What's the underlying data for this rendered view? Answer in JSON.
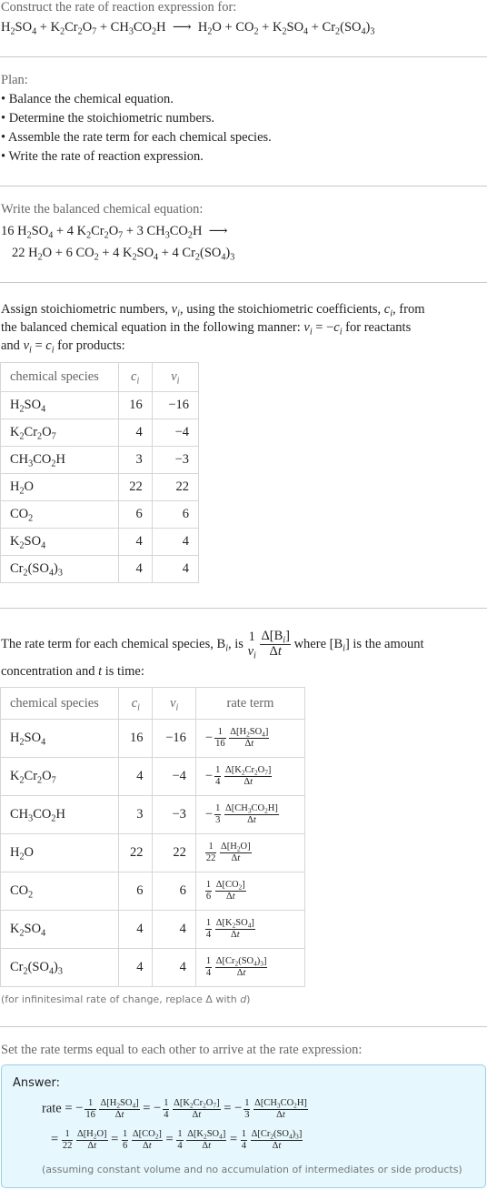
{
  "intro": {
    "prompt": "Construct the rate of reaction expression for:",
    "reaction": {
      "reactants": [
        "H2SO4",
        "K2Cr2O7",
        "CH3CO2H"
      ],
      "products": [
        "H2O",
        "CO2",
        "K2SO4",
        "Cr2(SO4)3"
      ],
      "arrow": "⟶"
    }
  },
  "plan": {
    "title": "Plan:",
    "steps": [
      "• Balance the chemical equation.",
      "• Determine the stoichiometric numbers.",
      "• Assemble the rate term for each chemical species.",
      "• Write the rate of reaction expression."
    ]
  },
  "balanced": {
    "title": "Write the balanced chemical equation:",
    "line1": "16 H2SO4 + 4 K2Cr2O7 + 3 CH3CO2H ⟶",
    "line2": "22 H2O + 6 CO2 + 4 K2SO4 + 4 Cr2(SO4)3"
  },
  "stoich": {
    "text_line1": "Assign stoichiometric numbers, νi, using the stoichiometric coefficients, ci, from",
    "text_line2": "the balanced chemical equation in the following manner: νi = −ci for reactants",
    "text_line3": "and νi = ci for products:",
    "headers": [
      "chemical species",
      "ci",
      "νi"
    ],
    "rows": [
      {
        "species": "H2SO4",
        "c": "16",
        "nu": "−16"
      },
      {
        "species": "K2Cr2O7",
        "c": "4",
        "nu": "−4"
      },
      {
        "species": "CH3CO2H",
        "c": "3",
        "nu": "−3"
      },
      {
        "species": "H2O",
        "c": "22",
        "nu": "22"
      },
      {
        "species": "CO2",
        "c": "6",
        "nu": "6"
      },
      {
        "species": "K2SO4",
        "c": "4",
        "nu": "4"
      },
      {
        "species": "Cr2(SO4)3",
        "c": "4",
        "nu": "4"
      }
    ]
  },
  "rate_terms": {
    "text_pre": "The rate term for each chemical species, Bi, is",
    "text_post": "where [Bi] is the amount",
    "text_line2": "concentration and t is time:",
    "headers": [
      "chemical species",
      "ci",
      "νi",
      "rate term"
    ],
    "rows": [
      {
        "species": "H2SO4",
        "c": "16",
        "nu": "−16",
        "sign": "−",
        "den": "16"
      },
      {
        "species": "K2Cr2O7",
        "c": "4",
        "nu": "−4",
        "sign": "−",
        "den": "4"
      },
      {
        "species": "CH3CO2H",
        "c": "3",
        "nu": "−3",
        "sign": "−",
        "den": "3"
      },
      {
        "species": "H2O",
        "c": "22",
        "nu": "22",
        "sign": "",
        "den": "22"
      },
      {
        "species": "CO2",
        "c": "6",
        "nu": "6",
        "sign": "",
        "den": "6"
      },
      {
        "species": "K2SO4",
        "c": "4",
        "nu": "4",
        "sign": "",
        "den": "4"
      },
      {
        "species": "Cr2(SO4)3",
        "c": "4",
        "nu": "4",
        "sign": "",
        "den": "4"
      }
    ],
    "footnote": "(for infinitesimal rate of change, replace Δ with d)"
  },
  "final": {
    "text": "Set the rate terms equal to each other to arrive at the rate expression:",
    "answer_label": "Answer:",
    "rate_label": "rate",
    "assumption": "(assuming constant volume and no accumulation of intermediates or side products)"
  }
}
